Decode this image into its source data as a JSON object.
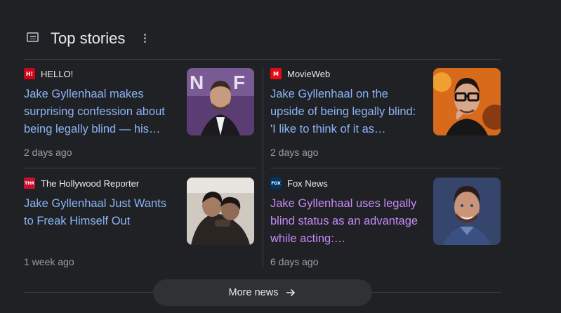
{
  "header": {
    "title": "Top stories",
    "icon": "newspaper-icon"
  },
  "stories": [
    {
      "source": "HELLO!",
      "logo_text": "H!",
      "logo_color": "#d0021b",
      "headline": "Jake Gyllenhaal makes surprising confession about being legally blind — his…",
      "time": "2 days ago",
      "visited": false
    },
    {
      "source": "MovieWeb",
      "logo_text": "M",
      "logo_color": "#e50914",
      "headline": "Jake Gyllenhaal on the upside of being legally blind: 'I like to think of it as…",
      "time": "2 days ago",
      "visited": false
    },
    {
      "source": "The Hollywood Reporter",
      "logo_text": "THR",
      "logo_color": "#c8102e",
      "headline": "Jake Gyllenhaal Just Wants to Freak Himself Out",
      "time": "1 week ago",
      "visited": false
    },
    {
      "source": "Fox News",
      "logo_text": "FOX",
      "logo_color": "#003366",
      "headline": "Jake Gyllenhaal uses legally blind status as an advantage while acting:…",
      "time": "6 days ago",
      "visited": true
    }
  ],
  "more_news": {
    "label": "More news"
  }
}
